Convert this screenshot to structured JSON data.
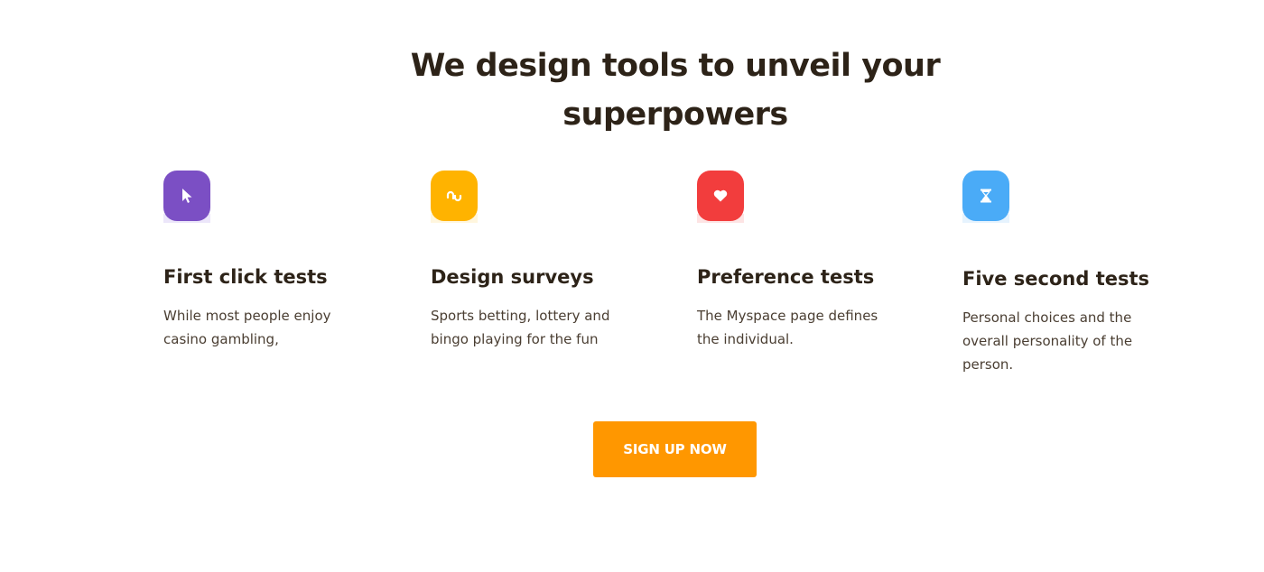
{
  "headline": {
    "line1": "We design tools to unveil your",
    "line2": "superpowers"
  },
  "features": [
    {
      "title": "First click tests",
      "description": "While most people enjoy casino gambling,",
      "icon": "cursor-icon",
      "color": "#7b4fc4",
      "shadow_color": "#c9b6f0"
    },
    {
      "title": "Design surveys",
      "description": "Sports betting, lottery and bingo playing for the fun",
      "icon": "stumbleupon-icon",
      "color": "#ffb300",
      "shadow_color": "#ffe5a0"
    },
    {
      "title": "Preference tests",
      "description": "The Myspace page defines the individual.",
      "icon": "heart-icon",
      "color": "#f23d3d",
      "shadow_color": "#f9b1b1"
    },
    {
      "title": "Five second tests",
      "description": "Personal choices and the overall personality of the person.",
      "icon": "hourglass-icon",
      "color": "#4aabf7",
      "shadow_color": "#b7dcfb"
    }
  ],
  "cta": {
    "label": "SIGN UP NOW",
    "color": "#ff9700"
  }
}
